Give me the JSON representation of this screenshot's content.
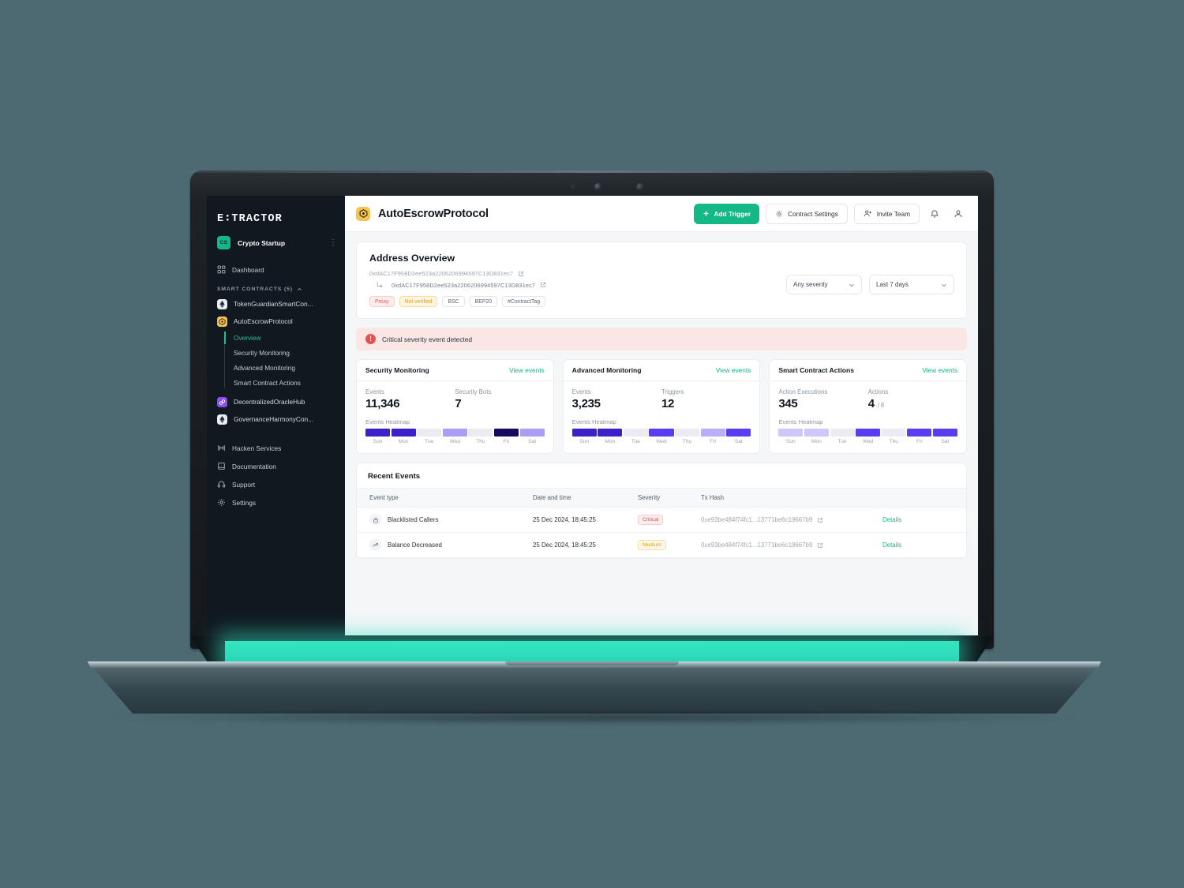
{
  "sidebar": {
    "logo": "E∶TRACTOR",
    "org": {
      "initials": "CS",
      "name": "Crypto Startup",
      "menu": "⋮"
    },
    "dashboard": "Dashboard",
    "section_label": "SMART CONTRACTS (5)",
    "contracts": [
      {
        "name": "TokenGuardianSmartCon...",
        "icon": "ethereum-icon"
      },
      {
        "name": "AutoEscrowProtocol",
        "icon": "bnb-icon"
      },
      {
        "name": "DecentralizedOracleHub",
        "icon": "oracle-icon"
      },
      {
        "name": "GovernanceHarmonyCon...",
        "icon": "ethereum-icon"
      }
    ],
    "subnav": [
      {
        "label": "Overview",
        "active": true
      },
      {
        "label": "Security Monitoring",
        "active": false
      },
      {
        "label": "Advanced Monitoring",
        "active": false
      },
      {
        "label": "Smart Contract Actions",
        "active": false
      }
    ],
    "bottom": [
      {
        "label": "Hacken Services",
        "icon": "services-icon"
      },
      {
        "label": "Documentation",
        "icon": "book-icon"
      },
      {
        "label": "Support",
        "icon": "headset-icon"
      },
      {
        "label": "Settings",
        "icon": "gear-icon"
      }
    ]
  },
  "topbar": {
    "title": "AutoEscrowProtocol",
    "add_trigger": "Add Trigger",
    "contract_settings": "Contract Settings",
    "invite_team": "Invite Team"
  },
  "overview": {
    "title": "Address Overview",
    "address": "0xdAC17F958D2ee523a2206206994597C13D831ec7",
    "implementation_address": "0xdAC17F958D2ee523a2206206994597C13D831ec7",
    "tags": [
      "Proxy",
      "Not verified",
      "BSC",
      "BEP20",
      "#ContractTag"
    ]
  },
  "filters": {
    "severity": "Any severity",
    "period": "Last 7 days"
  },
  "alert": {
    "text": "Critical severity event detected"
  },
  "cards": [
    {
      "title": "Security Monitoring",
      "link": "View events",
      "stats": [
        {
          "label": "Events",
          "value": "11,346"
        },
        {
          "label": "Security Bots",
          "value": "7"
        }
      ],
      "heatmap_label": "Events Heatmap",
      "days": [
        "Sun",
        "Mon",
        "Tue",
        "Wed",
        "Thu",
        "Fri",
        "Sat"
      ],
      "heat_colors": [
        "#3a22c8",
        "#3a22c8",
        "#ebecf1",
        "#a99df5",
        "#ebecf1",
        "#150b5e",
        "#a99df5"
      ]
    },
    {
      "title": "Advanced Monitoring",
      "link": "View events",
      "stats": [
        {
          "label": "Events",
          "value": "3,235"
        },
        {
          "label": "Triggers",
          "value": "12"
        }
      ],
      "heatmap_label": "Events Heatmap",
      "days": [
        "Sun",
        "Mon",
        "Tue",
        "Wed",
        "Thu",
        "Fri",
        "Sat"
      ],
      "heat_colors": [
        "#3a22c8",
        "#3a22c8",
        "#ebecf1",
        "#5b3df0",
        "#ebecf1",
        "#b9aef7",
        "#5b3df0"
      ]
    },
    {
      "title": "Smart Contract Actions",
      "link": "View events",
      "stats": [
        {
          "label": "Action Executions",
          "value": "345"
        },
        {
          "label": "Actions",
          "value": "4",
          "suffix": "/ 8"
        }
      ],
      "heatmap_label": "Events Heatmap",
      "days": [
        "Sun",
        "Mon",
        "Tue",
        "Wed",
        "Thu",
        "Fri",
        "Sat"
      ],
      "heat_colors": [
        "#cfc7fa",
        "#cfc7fa",
        "#ebecf1",
        "#5b3df0",
        "#ebecf1",
        "#5b3df0",
        "#5b3df0"
      ]
    }
  ],
  "events": {
    "title": "Recent Events",
    "columns": [
      "Event type",
      "Date and time",
      "Severity",
      "Tx Hash",
      ""
    ],
    "rows": [
      {
        "type": "Blacklisted Callers",
        "icon": "lock-icon",
        "date": "25 Dec 2024, 18:45:25",
        "severity": "Critical",
        "severity_level": "critical",
        "hash": "0xe93be484f74fc1...13771be6c19667b9",
        "details": "Details"
      },
      {
        "type": "Balance Decreased",
        "icon": "trend-icon",
        "date": "25 Dec 2024, 18:45:25",
        "severity": "Medium",
        "severity_level": "medium",
        "hash": "0xe93be484f74fc1...13771be6c19667b9",
        "details": "Details"
      }
    ]
  },
  "colors": {
    "background": "#4d6a72",
    "accent": "#12b886",
    "glow": "#33e2c4",
    "sidebar": "#111820",
    "critical": "#dd5555",
    "medium": "#dfa125"
  }
}
